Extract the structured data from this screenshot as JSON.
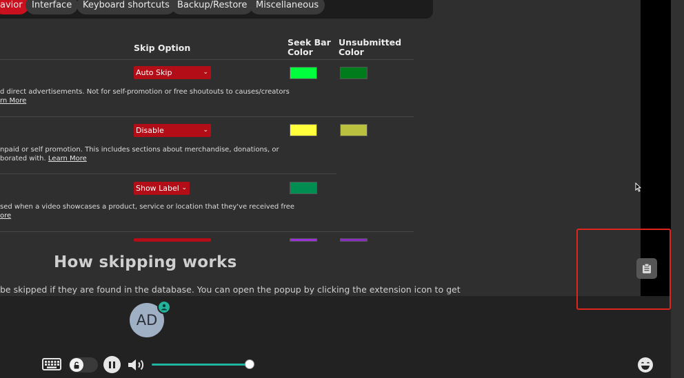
{
  "tabs": [
    {
      "label": "avior",
      "active": true
    },
    {
      "label": "Interface",
      "active": false
    },
    {
      "label": "Keyboard shortcuts",
      "active": false
    },
    {
      "label": "Backup/Restore",
      "active": false
    },
    {
      "label": "Miscellaneous",
      "active": false
    }
  ],
  "table": {
    "headers": {
      "skip_option": "Skip Option",
      "seek_bar_color_1": "Seek Bar",
      "seek_bar_color_2": "Color",
      "unsubmitted_color_1": "Unsubmitted",
      "unsubmitted_color_2": "Color"
    },
    "rows": [
      {
        "skip_option": "Auto Skip",
        "seek_color": "#00ff3c",
        "unsubmitted_color": "#007c1c",
        "desc_line1": "d direct advertisements. Not for self-promotion or free shoutouts to causes/creators",
        "desc_line2_prefix": "",
        "learn_more": "rn More"
      },
      {
        "skip_option": "Disable",
        "seek_color": "#ffff3c",
        "unsubmitted_color": "#b9c040",
        "desc_line1": "npaid or self promotion. This includes sections about merchandise, donations, or",
        "desc_line2_prefix": "borated with. ",
        "learn_more": "Learn More"
      },
      {
        "skip_option": "Show Label",
        "seek_color": "#008d52",
        "unsubmitted_color": "",
        "desc_line1": "sed when a video showcases a product, service or location that they've received free",
        "desc_line2_prefix": "",
        "learn_more": "ore"
      },
      {
        "skip_option": "",
        "seek_color": "#9b2fd9",
        "unsubmitted_color": "#8a2bc4"
      }
    ]
  },
  "how_skipping_works": {
    "title": "How skipping works",
    "text": "be skipped if they are found in the database. You can open the popup by clicking the extension icon to get"
  },
  "session": {
    "avatar_initials": "AD"
  },
  "icons": {
    "clipboard": "clipboard-icon",
    "keyboard": "keyboard-icon",
    "lock": "unlock-icon",
    "pause": "pause-icon",
    "volume": "volume-icon",
    "emoji": "emoji-icon",
    "user_badge": "user-icon",
    "cursor": "mouse-cursor-icon"
  },
  "colors": {
    "accent_red": "#c8101e",
    "select_red": "#b30d17",
    "teal": "#1fb5a0",
    "highlight_box": "#e0251d"
  },
  "volume_level": 1.0
}
